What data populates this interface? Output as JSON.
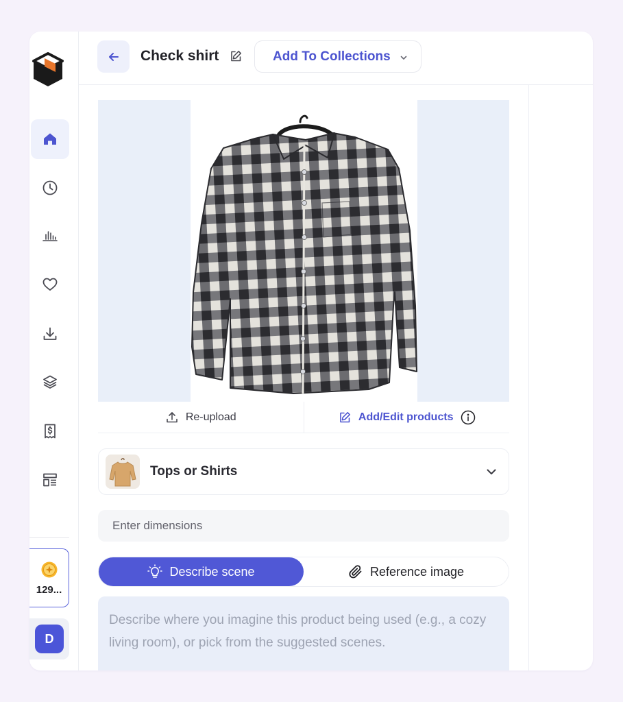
{
  "header": {
    "title": "Check shirt",
    "collections_label": "Add To Collections"
  },
  "sidebar": {
    "items": [
      {
        "name": "home",
        "icon": "home-icon",
        "active": true
      },
      {
        "name": "history",
        "icon": "clock-icon",
        "active": false
      },
      {
        "name": "analytics",
        "icon": "bar-chart-icon",
        "active": false
      },
      {
        "name": "favorites",
        "icon": "heart-icon",
        "active": false
      },
      {
        "name": "downloads",
        "icon": "download-icon",
        "active": false
      },
      {
        "name": "layers",
        "icon": "layers-icon",
        "active": false
      },
      {
        "name": "billing",
        "icon": "receipt-dollar-icon",
        "active": false
      },
      {
        "name": "templates",
        "icon": "layout-icon",
        "active": false
      }
    ],
    "credits": "129...",
    "avatar_initial": "D"
  },
  "product": {
    "reupload_label": "Re-upload",
    "add_edit_label": "Add/Edit products",
    "image_icon": "checkered-shirt-image"
  },
  "category": {
    "label": "Tops or Shirts"
  },
  "dimensions": {
    "placeholder": "Enter dimensions"
  },
  "scene_tabs": {
    "describe_label": "Describe scene",
    "reference_label": "Reference image",
    "active": "describe"
  },
  "scene": {
    "placeholder": "Describe where you imagine this product being used (e.g., a cozy living room), or pick from the suggested scenes."
  },
  "colors": {
    "accent": "#4d55d0",
    "accent_fill": "#5058d6",
    "active_nav_bg": "#eef1fc",
    "image_bg": "#e9eff9",
    "logo_orange": "#e8762b"
  }
}
